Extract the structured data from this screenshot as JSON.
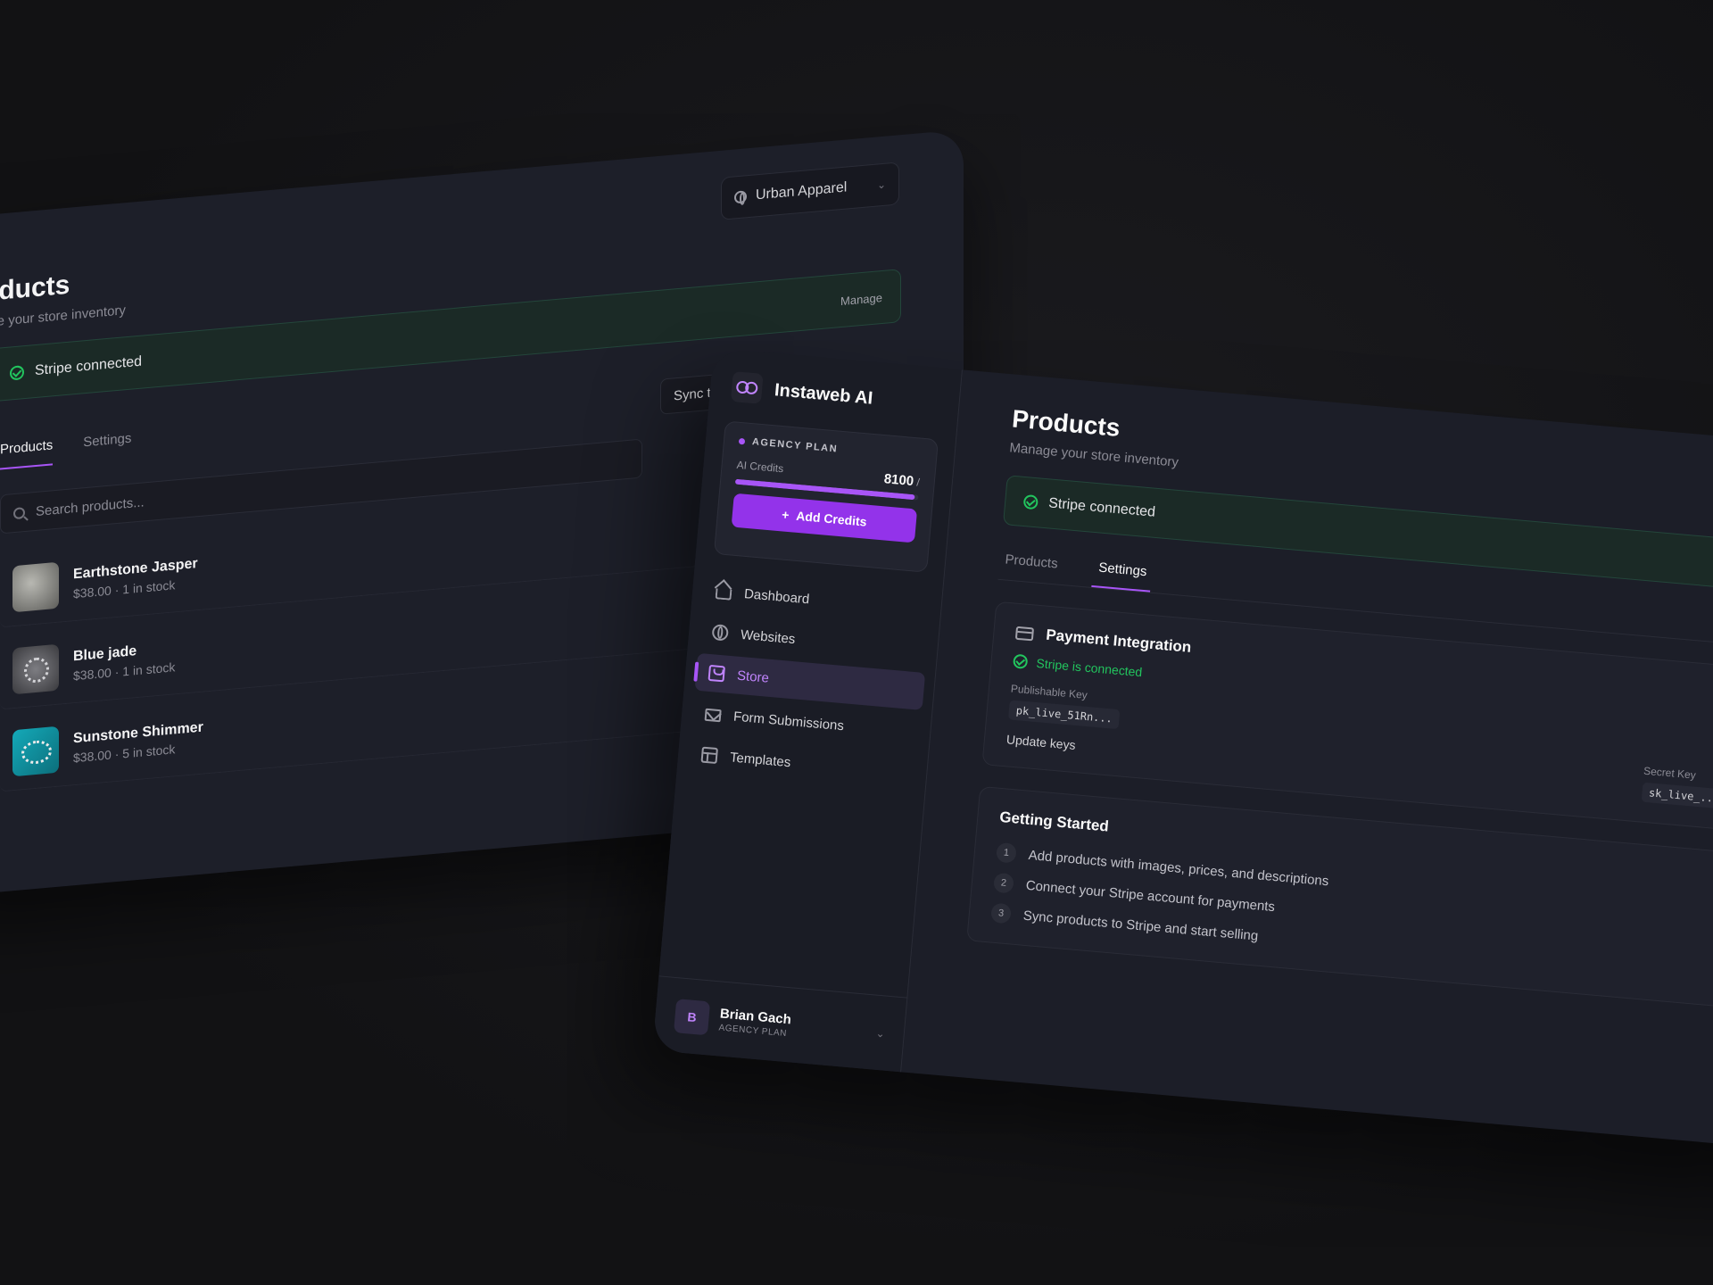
{
  "back_window": {
    "site_selector": "Urban Apparel",
    "title": "oducts",
    "subtitle": "age your store inventory",
    "stripe_status": "Stripe connected",
    "manage_label": "Manage",
    "tabs": [
      {
        "label": "Products",
        "active": true
      },
      {
        "label": "Settings",
        "active": false
      }
    ],
    "sync_label": "Sync to Strip",
    "search_placeholder": "Search products...",
    "products": [
      {
        "name": "Earthstone Jasper",
        "meta": "$38.00 · 1 in stock"
      },
      {
        "name": "Blue jade",
        "meta": "$38.00 · 1 in stock"
      },
      {
        "name": "Sunstone Shimmer",
        "meta": "$38.00 · 5 in stock"
      }
    ]
  },
  "sidebar": {
    "brand": "Instaweb AI",
    "plan_label": "AGENCY PLAN",
    "credits_label": "AI Credits",
    "credits_value": "8100",
    "credits_suffix": "/",
    "credits_fill_fraction": 0.98,
    "add_credits_label": "Add Credits",
    "nav": [
      {
        "label": "Dashboard",
        "icon": "home-icon",
        "active": false
      },
      {
        "label": "Websites",
        "icon": "globe-icon",
        "active": false
      },
      {
        "label": "Store",
        "icon": "bag-icon",
        "active": true
      },
      {
        "label": "Form Submissions",
        "icon": "mail-icon",
        "active": false
      },
      {
        "label": "Templates",
        "icon": "layout-icon",
        "active": false
      }
    ],
    "user": {
      "initial": "B",
      "name": "Brian Gach",
      "plan": "AGENCY PLAN"
    }
  },
  "main": {
    "title": "Products",
    "subtitle": "Manage your store inventory",
    "stripe_status": "Stripe connected",
    "tabs": [
      {
        "label": "Products",
        "active": false
      },
      {
        "label": "Settings",
        "active": true
      }
    ],
    "payment": {
      "title": "Payment Integration",
      "status": "Stripe is connected",
      "publishable_label": "Publishable Key",
      "publishable_value": "pk_live_51Rn...",
      "secret_label": "Secret Key",
      "secret_value": "sk_live_...",
      "update_label": "Update keys"
    },
    "getting_started": {
      "title": "Getting Started",
      "steps": [
        {
          "num": "1",
          "text": "Add products with images, prices, and descriptions"
        },
        {
          "num": "2",
          "text": "Connect your Stripe account for payments"
        },
        {
          "num": "3",
          "text": "Sync products to Stripe and start selling"
        }
      ]
    }
  },
  "colors": {
    "accent": "#a855f7",
    "success": "#22c55e",
    "background": "#141416"
  }
}
